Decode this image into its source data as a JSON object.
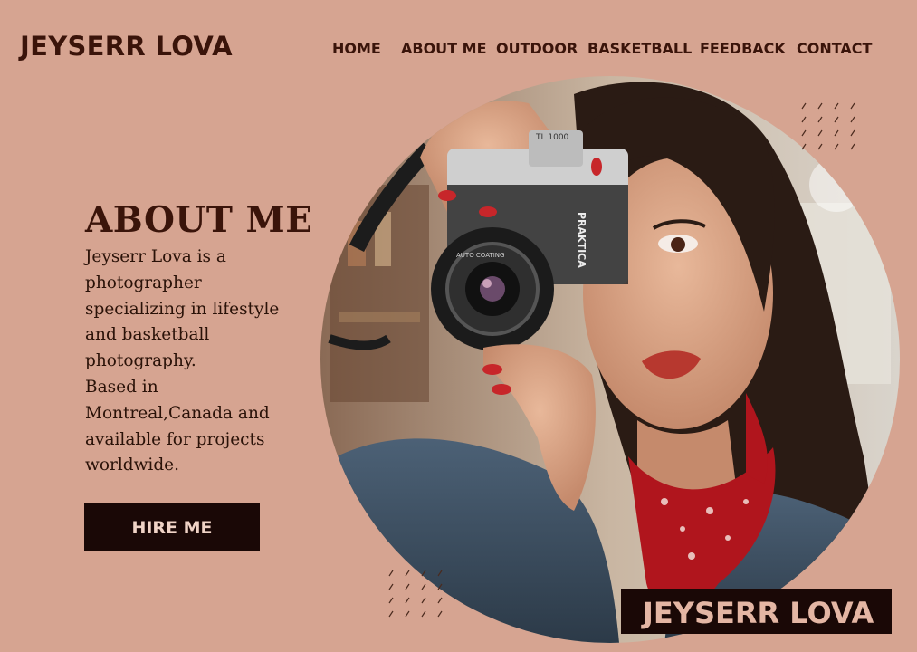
{
  "header": {
    "logo": "JEYSERR LOVA"
  },
  "nav": {
    "items": [
      {
        "label": "HOME"
      },
      {
        "label": "ABOUT ME"
      },
      {
        "label": "OUTDOOR"
      },
      {
        "label": "BASKETBALL"
      },
      {
        "label": "FEEDBACK"
      },
      {
        "label": "CONTACT"
      }
    ]
  },
  "about": {
    "heading": "ABOUT ME",
    "bio_lines": [
      "Jeyserr Lova is a",
      "photographer",
      "specializing in lifestyle",
      "and basketball",
      "photography.",
      "Based in",
      "Montreal,Canada and",
      "available for projects",
      "worldwide."
    ],
    "cta_label": "HIRE ME"
  },
  "hero": {
    "camera_brand": "PRAKTICA",
    "camera_model": "TL 1000",
    "lens_label": "AUTO COATING",
    "banner_text": "JEYSERR LOVA"
  },
  "colors": {
    "background": "#d6a491",
    "text_dark": "#3a140a",
    "button_bg": "#1a0806",
    "button_text": "#f0d3c6",
    "bandana_red": "#b0151d"
  }
}
